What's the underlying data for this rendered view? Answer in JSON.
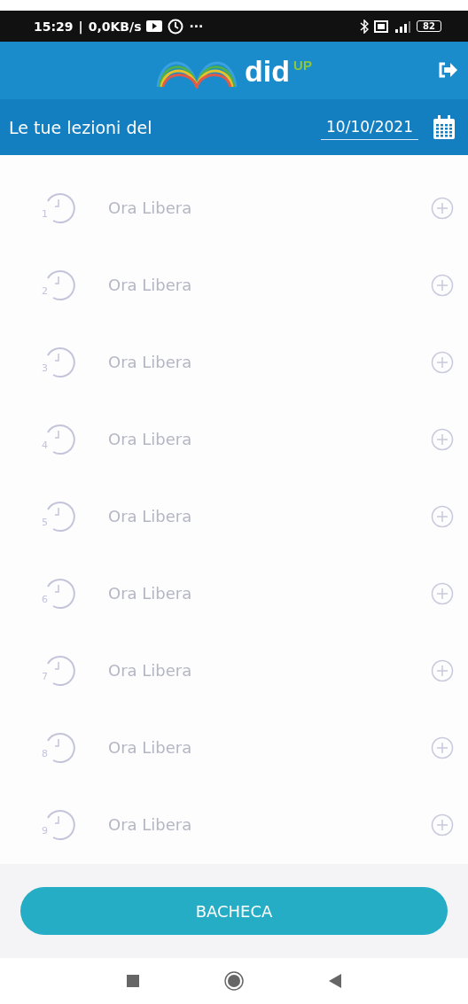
{
  "status_bar": {
    "time": "15:29",
    "separator": "|",
    "speed": "0,0KB/s",
    "more": "···",
    "battery": "82"
  },
  "header": {
    "logo_text": "did",
    "logo_sup": "UP"
  },
  "date_bar": {
    "label": "Le tue lezioni del",
    "date": "10/10/2021"
  },
  "lessons": [
    {
      "hour": "1",
      "title": "Ora Libera"
    },
    {
      "hour": "2",
      "title": "Ora Libera"
    },
    {
      "hour": "3",
      "title": "Ora Libera"
    },
    {
      "hour": "4",
      "title": "Ora Libera"
    },
    {
      "hour": "5",
      "title": "Ora Libera"
    },
    {
      "hour": "6",
      "title": "Ora Libera"
    },
    {
      "hour": "7",
      "title": "Ora Libera"
    },
    {
      "hour": "8",
      "title": "Ora Libera"
    },
    {
      "hour": "9",
      "title": "Ora Libera"
    }
  ],
  "button": {
    "label": "BACHECA"
  }
}
